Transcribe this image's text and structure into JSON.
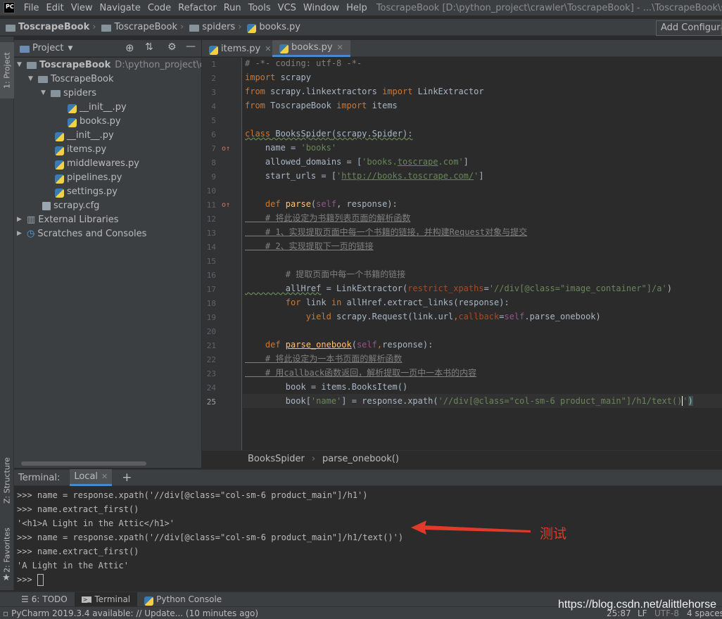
{
  "app": {
    "logo": "PC",
    "menu": [
      "File",
      "Edit",
      "View",
      "Navigate",
      "Code",
      "Refactor",
      "Run",
      "Tools",
      "VCS",
      "Window",
      "Help"
    ],
    "window_title": "ToscrapeBook [D:\\python_project\\crawler\\ToscrapeBook] - ...\\ToscrapeBook\\spiders\\books.py [ToscrapeBook] - PyCharm"
  },
  "navbar": {
    "crumbs": [
      "ToscrapeBook",
      "ToscrapeBook",
      "spiders",
      "books.py"
    ],
    "add_config": "Add Configuration..."
  },
  "left_strip": {
    "project_tab": "1: Project",
    "structure_tab": "Z: Structure",
    "favorites_tab": "2: Favorites"
  },
  "project": {
    "header": "Project",
    "tree": [
      {
        "label": "ToscrapeBook",
        "hint": "D:\\python_project\\crawler\\ToscrapeBook",
        "kind": "folder"
      },
      {
        "label": "ToscrapeBook",
        "kind": "folder"
      },
      {
        "label": "spiders",
        "kind": "folder"
      },
      {
        "label": "__init__.py",
        "kind": "py"
      },
      {
        "label": "books.py",
        "kind": "py"
      },
      {
        "label": "__init__.py",
        "kind": "py"
      },
      {
        "label": "items.py",
        "kind": "py"
      },
      {
        "label": "middlewares.py",
        "kind": "py"
      },
      {
        "label": "pipelines.py",
        "kind": "py"
      },
      {
        "label": "settings.py",
        "kind": "py"
      },
      {
        "label": "scrapy.cfg",
        "kind": "cfg"
      },
      {
        "label": "External Libraries",
        "kind": "lib"
      },
      {
        "label": "Scratches and Consoles",
        "kind": "scratch"
      }
    ]
  },
  "tabs": [
    {
      "label": "items.py"
    },
    {
      "label": "books.py"
    }
  ],
  "editor": {
    "line_numbers": [
      "1",
      "2",
      "3",
      "4",
      "5",
      "6",
      "7",
      "8",
      "9",
      "10",
      "11",
      "12",
      "13",
      "14",
      "15",
      "16",
      "17",
      "18",
      "19",
      "20",
      "21",
      "22",
      "23",
      "24",
      "25"
    ],
    "lines": {
      "l1": "# -*- coding: utf-8 -*-",
      "l2a": "import",
      "l2b": " scrapy",
      "l3a": "from",
      "l3b": " scrapy.linkextractors ",
      "l3c": "import",
      "l3d": " LinkExtractor",
      "l4a": "from",
      "l4b": " ToscrapeBook ",
      "l4c": "import",
      "l4d": " items",
      "l6a": "class",
      "l6b": " BooksSpider",
      "l6c": "(scrapy.Spider):",
      "l7a": "    name = ",
      "l7b": "'books'",
      "l8a": "    allowed_domains = [",
      "l8b": "'books.",
      "l8c": "toscrape",
      "l8d": ".com'",
      "l8e": "]",
      "l9a": "    start_urls = [",
      "l9b": "'",
      "l9c": "http://books.toscrape.com/",
      "l9d": "'",
      "l9e": "]",
      "l11a": "    def ",
      "l11b": "parse",
      "l11c": "(",
      "l11d": "self",
      "l11e": ", response):",
      "l12": "    # 将此设定为书籍列表页面的解析函数",
      "l13": "    # 1、实现提取页面中每一个书籍的链接，并构建Request对象与提交",
      "l14": "    # 2、实现提取下一页的链接",
      "l16": "        # 提取页面中每一个书籍的链接",
      "l17a": "        allHref",
      "l17b": " = LinkExtractor(",
      "l17c": "restrict_xpaths",
      "l17d": "=",
      "l17e": "'//div[@class=\"image_container\"]/a'",
      "l17f": ")",
      "l18a": "        for",
      "l18b": " link ",
      "l18c": "in",
      "l18d": " allHref.extract_links(response):",
      "l19a": "            yield",
      "l19b": " scrapy.Request(link.url",
      "l19c": ",",
      "l19d": "callback",
      "l19e": "=",
      "l19f": "self",
      "l19g": ".parse_onebook)",
      "l21a": "    def ",
      "l21b": "parse_onebook",
      "l21c": "(",
      "l21d": "self",
      "l21e": ",",
      "l21f": "response):",
      "l22": "    # 将此设定为一本书页面的解析函数",
      "l23": "    # 用callback函数返回，解析提取一页中一本书的内容",
      "l24": "        book = items.BooksItem()",
      "l25a": "        book[",
      "l25b": "'name'",
      "l25c": "] = response.xpath(",
      "l25d": "'//div[@class=\"col-sm-6 product_main\"]/h1/text()",
      "l25e": "'",
      "l25f": ")"
    }
  },
  "breadcrumb": [
    "BooksSpider",
    "parse_onebook()"
  ],
  "terminal": {
    "title": "Terminal:",
    "tab": "Local",
    "lines": [
      ">>> name = response.xpath('//div[@class=\"col-sm-6 product_main\"]/h1')",
      ">>> name.extract_first()",
      "'<h1>A Light in the Attic</h1>'",
      ">>> name = response.xpath('//div[@class=\"col-sm-6 product_main\"]/h1/text()')",
      ">>> name.extract_first()",
      "'A Light in the Attic'",
      ">>> "
    ]
  },
  "annotation": {
    "text": "测试",
    "color": "#e23a2a"
  },
  "bottom_tabs": [
    "6: TODO",
    "Terminal",
    "Python Console"
  ],
  "status": {
    "message": "PyCharm 2019.3.4 available: // Update... (10 minutes ago)",
    "position": "25:87",
    "line_sep": "LF",
    "encoding": "UTF-8",
    "indent": "4 spaces"
  },
  "watermark": "https://blog.csdn.net/alittlehorse"
}
